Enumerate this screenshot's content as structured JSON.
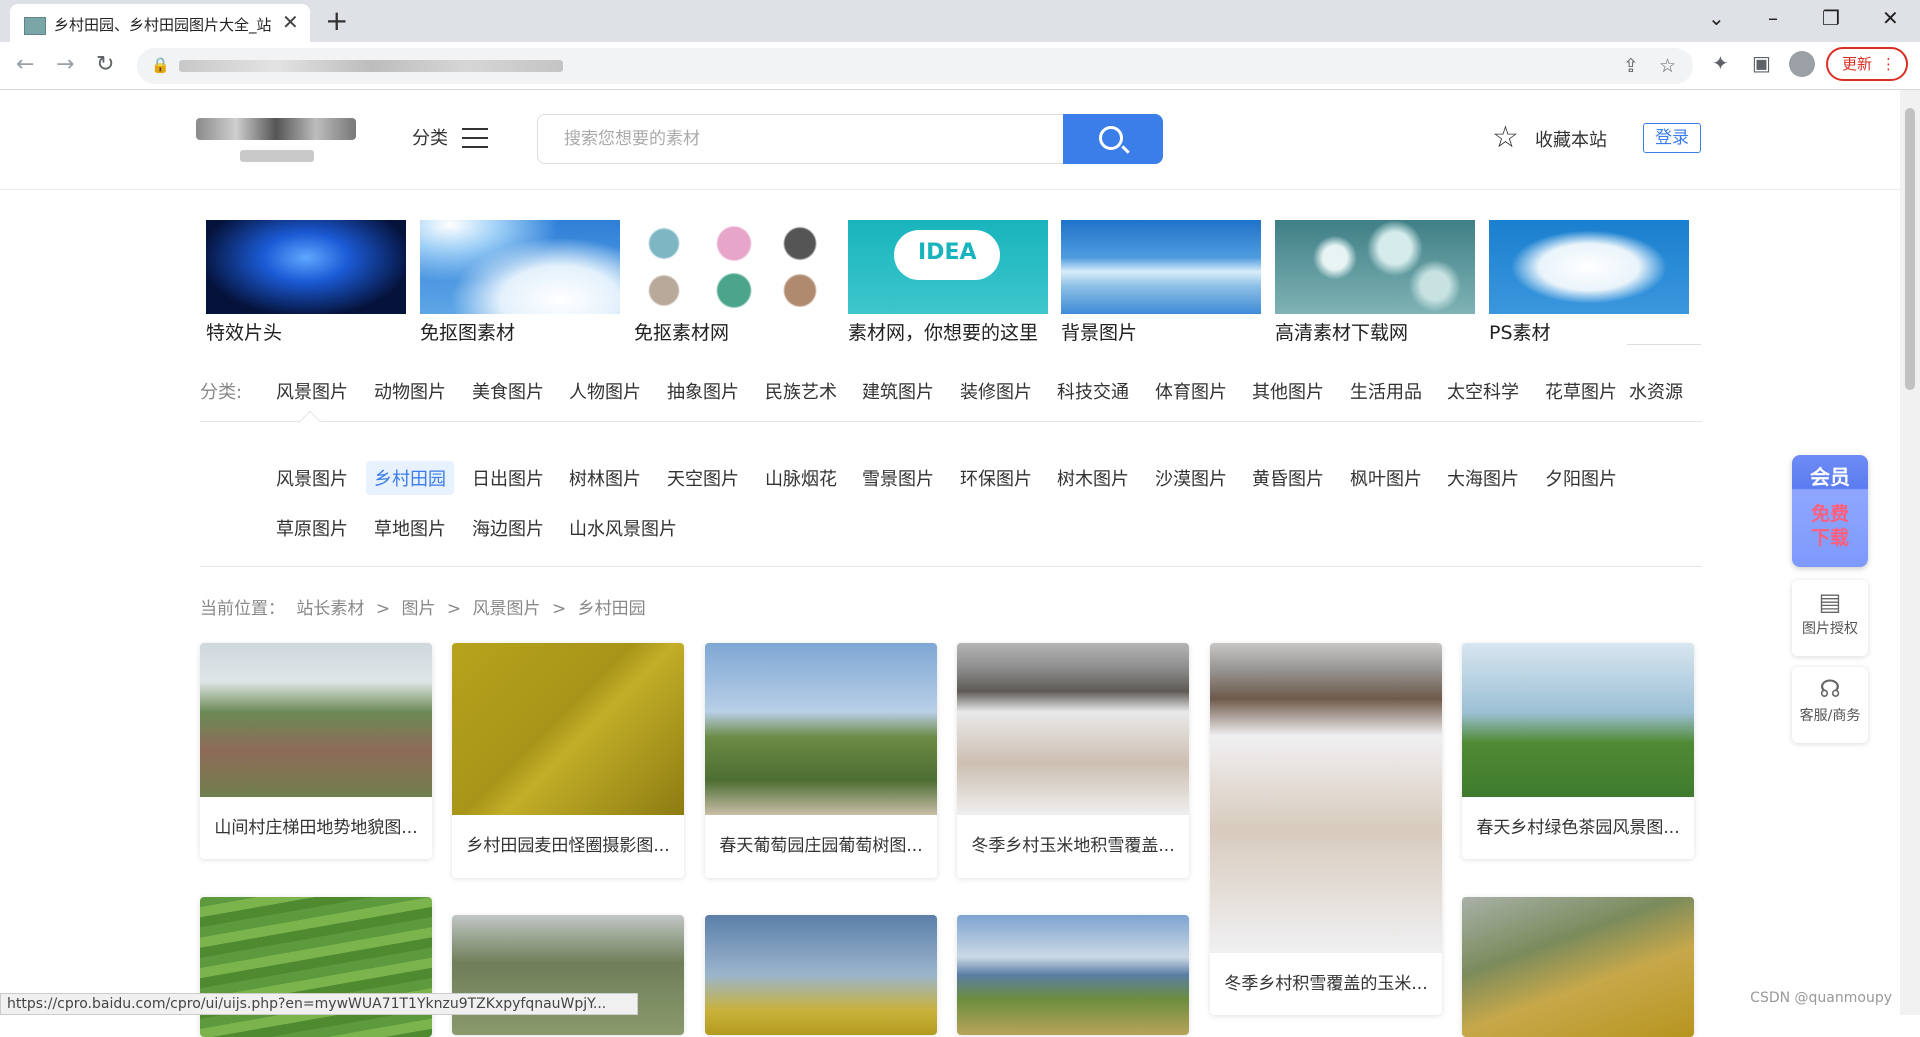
{
  "browser": {
    "tab_title": "乡村田园、乡村田园图片大全_站",
    "tab_close": "✕",
    "new_tab": "+",
    "update_label": "更新",
    "status_url": "https://cpro.baidu.com/cpro/ui/uijs.php?en=mywWUA71T1Yknzu9TZKxpyfqnauWpjY..."
  },
  "header": {
    "category_label": "分类",
    "search_placeholder": "搜索您想要的素材",
    "favorite_label": "收藏本站",
    "login_label": "登录"
  },
  "featured": [
    {
      "label": "特效片头",
      "colors": [
        "#05123a",
        "#1b5bd6"
      ]
    },
    {
      "label": "免抠图素材",
      "colors": [
        "#2f7fd8",
        "#cde6fb"
      ]
    },
    {
      "label": "免抠素材网",
      "colors": [
        "#ffffff",
        "#e9eef2"
      ]
    },
    {
      "label": "素材网，你想要的这里",
      "colors": [
        "#18b4bd",
        "#58d2d6"
      ]
    },
    {
      "label": "背景图片",
      "colors": [
        "#1f73c9",
        "#b9dbf4"
      ]
    },
    {
      "label": "高清素材下载网",
      "colors": [
        "#3f7f86",
        "#b9d8d8"
      ]
    },
    {
      "label": "PS素材",
      "colors": [
        "#1a7fcf",
        "#e7f2fb"
      ]
    }
  ],
  "categories": {
    "label": "分类:",
    "items": [
      "风景图片",
      "动物图片",
      "美食图片",
      "人物图片",
      "抽象图片",
      "民族艺术",
      "建筑图片",
      "装修图片",
      "科技交通",
      "体育图片",
      "其他图片",
      "生活用品",
      "太空科学",
      "花草图片",
      "水资源"
    ]
  },
  "subcategories": {
    "row1": [
      "风景图片",
      "乡村田园",
      "日出图片",
      "树林图片",
      "天空图片",
      "山脉烟花",
      "雪景图片",
      "环保图片",
      "树木图片",
      "沙漠图片",
      "黄昏图片",
      "枫叶图片",
      "大海图片",
      "夕阳图片"
    ],
    "row2": [
      "草原图片",
      "草地图片",
      "海边图片",
      "山水风景图片"
    ],
    "active": "乡村田园"
  },
  "breadcrumb": {
    "prefix": "当前位置：",
    "items": [
      "站长素材",
      ">",
      "图片",
      ">",
      "风景图片",
      ">",
      "乡村田园"
    ]
  },
  "gallery": [
    {
      "caption": "山间村庄梯田地势地貌图...",
      "colors": [
        "#cfd8de",
        "#6b8a55",
        "#8e6a58"
      ]
    },
    {
      "caption": "乡村田园麦田怪圈摄影图...",
      "colors": [
        "#b7a31c",
        "#a89418",
        "#8c7c12"
      ]
    },
    {
      "caption": "春天葡萄园庄园葡萄树图...",
      "colors": [
        "#7ea7d4",
        "#b8cfe6",
        "#4d6e33"
      ]
    },
    {
      "caption": "冬季乡村玉米地积雪覆盖...",
      "colors": [
        "#8c8c8c",
        "#e9e9ea",
        "#a3826a"
      ]
    },
    {
      "caption": "冬季乡村积雪覆盖的玉米...",
      "colors": [
        "#9a9896",
        "#f0f0f2",
        "#9a7a5a"
      ]
    },
    {
      "caption": "春天乡村绿色茶园风景图...",
      "colors": [
        "#c7dbe8",
        "#9cc0d6",
        "#3f7b2e"
      ]
    },
    {
      "caption": "",
      "colors": [
        "#5d9a3e",
        "#7bb34c",
        "#4f8a31"
      ]
    },
    {
      "caption": "",
      "colors": [
        "#c2c7c5",
        "#6f7e59",
        "#8a9a6c"
      ]
    },
    {
      "caption": "",
      "colors": [
        "#5b7fa8",
        "#9bb5cc",
        "#c9b23a"
      ]
    },
    {
      "caption": "",
      "colors": [
        "#7ea3d0",
        "#cbd9e5",
        "#6c8d3e"
      ]
    },
    {
      "caption": "",
      "colors": [
        "#a9b1a8",
        "#c7a84a",
        "#b7951f"
      ]
    }
  ],
  "sidebar": {
    "vip_title": "会员",
    "vip_sub": "免费下载",
    "license_label": "图片授权",
    "service_label": "客服/商务"
  },
  "watermark": "CSDN @quanmoupy"
}
